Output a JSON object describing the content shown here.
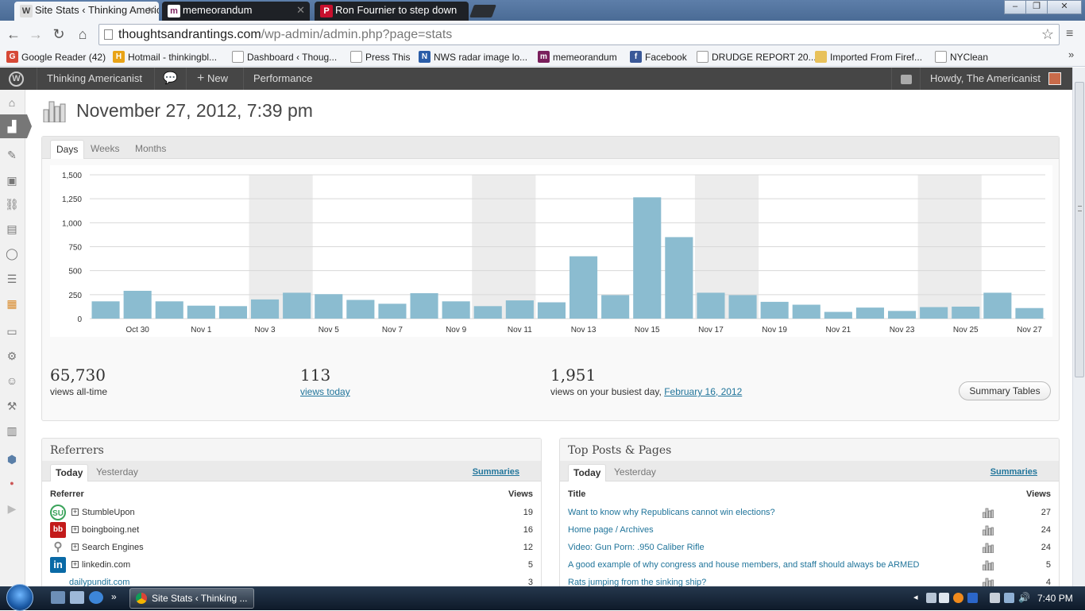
{
  "browser": {
    "tabs": [
      {
        "title": "Site Stats ‹ Thinking Americanist",
        "icon": "wordpress-icon",
        "active": true
      },
      {
        "title": "memeorandum",
        "icon": "memeorandum-icon",
        "active": false
      },
      {
        "title": "Ron Fournier to step down",
        "icon": "politico-icon",
        "active": false
      }
    ],
    "url_host": "thoughtsandrantings.com",
    "url_path": "/wp-admin/admin.php?page=stats",
    "bookmarks": [
      "Google Reader (42)",
      "Hotmail - thinkingbl...",
      "Dashboard ‹ Thoug...",
      "Press This",
      "NWS radar image lo...",
      "memeorandum",
      "Facebook",
      "DRUDGE REPORT 20...",
      "Imported From Firef...",
      "NYClean"
    ]
  },
  "adminbar": {
    "site_name": "Thinking Americanist",
    "new_label": "New",
    "performance_label": "Performance",
    "howdy": "Howdy, The Americanist"
  },
  "page": {
    "title": "November 27, 2012, 7:39 pm",
    "period_tabs": [
      "Days",
      "Weeks",
      "Months"
    ],
    "active_period": "Days"
  },
  "chart_data": {
    "type": "bar",
    "categories": [
      "Oct 29",
      "Oct 30",
      "Oct 31",
      "Nov 1",
      "Nov 2",
      "Nov 3",
      "Nov 4",
      "Nov 5",
      "Nov 6",
      "Nov 7",
      "Nov 8",
      "Nov 9",
      "Nov 10",
      "Nov 11",
      "Nov 12",
      "Nov 13",
      "Nov 14",
      "Nov 15",
      "Nov 16",
      "Nov 17",
      "Nov 18",
      "Nov 19",
      "Nov 20",
      "Nov 21",
      "Nov 22",
      "Nov 23",
      "Nov 24",
      "Nov 25",
      "Nov 26",
      "Nov 27"
    ],
    "tick_labels": [
      "Oct 30",
      "Nov 1",
      "Nov 3",
      "Nov 5",
      "Nov 7",
      "Nov 9",
      "Nov 11",
      "Nov 13",
      "Nov 15",
      "Nov 17",
      "Nov 19",
      "Nov 21",
      "Nov 23",
      "Nov 25",
      "Nov 27"
    ],
    "values": [
      180,
      290,
      180,
      135,
      130,
      200,
      270,
      255,
      195,
      155,
      265,
      180,
      130,
      190,
      170,
      650,
      245,
      1265,
      850,
      270,
      245,
      175,
      145,
      70,
      115,
      80,
      120,
      125,
      270,
      110
    ],
    "yticks": [
      "0",
      "250",
      "500",
      "750",
      "1,000",
      "1,250",
      "1,500"
    ],
    "ylim": [
      0,
      1500
    ],
    "grid": true,
    "weekend_bands": [
      "Nov 3–Nov 4",
      "Nov 10–Nov 11",
      "Nov 17–Nov 18",
      "Nov 24–Nov 25"
    ],
    "bar_color": "#8bbcd0",
    "band_color": "#ececec"
  },
  "summary": {
    "all_time_value": "65,730",
    "all_time_label": "views all-time",
    "today_value": "113",
    "today_label": "views today",
    "busiest_value": "1,951",
    "busiest_label": "views on your busiest day,",
    "busiest_date": "February 16, 2012",
    "summary_tables_button": "Summary Tables"
  },
  "referrers": {
    "title": "Referrers",
    "tabs": [
      "Today",
      "Yesterday"
    ],
    "summaries_label": "Summaries",
    "col_name": "Referrer",
    "col_views": "Views",
    "rows": [
      {
        "name": "StumbleUpon",
        "views": "19"
      },
      {
        "name": "boingboing.net",
        "views": "16"
      },
      {
        "name": "Search Engines",
        "views": "12"
      },
      {
        "name": "linkedin.com",
        "views": "5"
      },
      {
        "name": "dailypundit.com",
        "views": "3"
      }
    ]
  },
  "top_posts": {
    "title": "Top Posts & Pages",
    "tabs": [
      "Today",
      "Yesterday"
    ],
    "summaries_label": "Summaries",
    "col_name": "Title",
    "col_views": "Views",
    "rows": [
      {
        "name": "Want to know why Republicans cannot win elections?",
        "views": "27"
      },
      {
        "name": "Home page / Archives",
        "views": "24"
      },
      {
        "name": "Video: Gun Porn: .950 Caliber Rifle",
        "views": "24"
      },
      {
        "name": "A good example of why congress and house members, and staff should always be ARMED",
        "views": "5"
      },
      {
        "name": "Rats jumping from the sinking ship?",
        "views": "4"
      }
    ]
  },
  "taskbar": {
    "task_label": "Site Stats ‹ Thinking ...",
    "clock": "7:40 PM"
  }
}
